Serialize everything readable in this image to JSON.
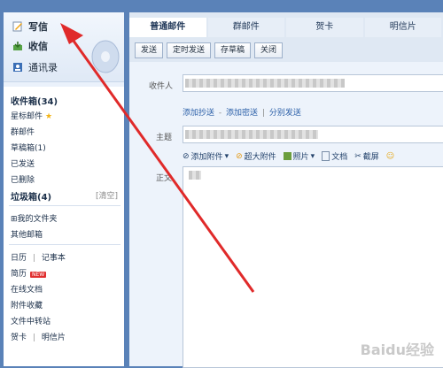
{
  "sidebar": {
    "compose_label": "写信",
    "inbox_label": "收信",
    "contacts_label": "通讯录",
    "folders": [
      {
        "label": "收件箱(34)",
        "bold": true
      },
      {
        "label": "星标邮件",
        "star": true
      },
      {
        "label": "群邮件"
      },
      {
        "label": "草稿箱(1)"
      },
      {
        "label": "已发送"
      },
      {
        "label": "已删除"
      }
    ],
    "trash_label": "垃圾箱(4)",
    "trash_clear": "[清空]",
    "myfolders": "⊞我的文件夹",
    "other_mailboxes": "其他邮箱",
    "calendar": "日历",
    "notes": "记事本",
    "resume": "简历",
    "new_badge": "NEW",
    "online_docs": "在线文档",
    "attachment_collection": "附件收藏",
    "file_transfer": "文件中转站",
    "greeting_cards": "贺卡",
    "postcards": "明信片",
    "divider": "|"
  },
  "tabs": [
    "普通邮件",
    "群邮件",
    "贺卡",
    "明信片"
  ],
  "toolbar": {
    "send": "发送",
    "scheduled_send": "定时发送",
    "save_draft": "存草稿",
    "close": "关闭"
  },
  "compose": {
    "to_label": "收件人",
    "add_cc": "添加抄送",
    "add_bcc": "添加密送",
    "separate_send": "分别发送",
    "dash": "-",
    "pipe": "|",
    "subject_label": "主题",
    "body_label": "正文",
    "add_attachment": "添加附件",
    "large_attachment": "超大附件",
    "photo": "照片",
    "document": "文档",
    "screenshot": "截屏"
  },
  "watermark": "Baidu经验",
  "colors": {
    "arrow": "#e02a2a",
    "link": "#2b5fa8",
    "background": "#5a82b8"
  }
}
